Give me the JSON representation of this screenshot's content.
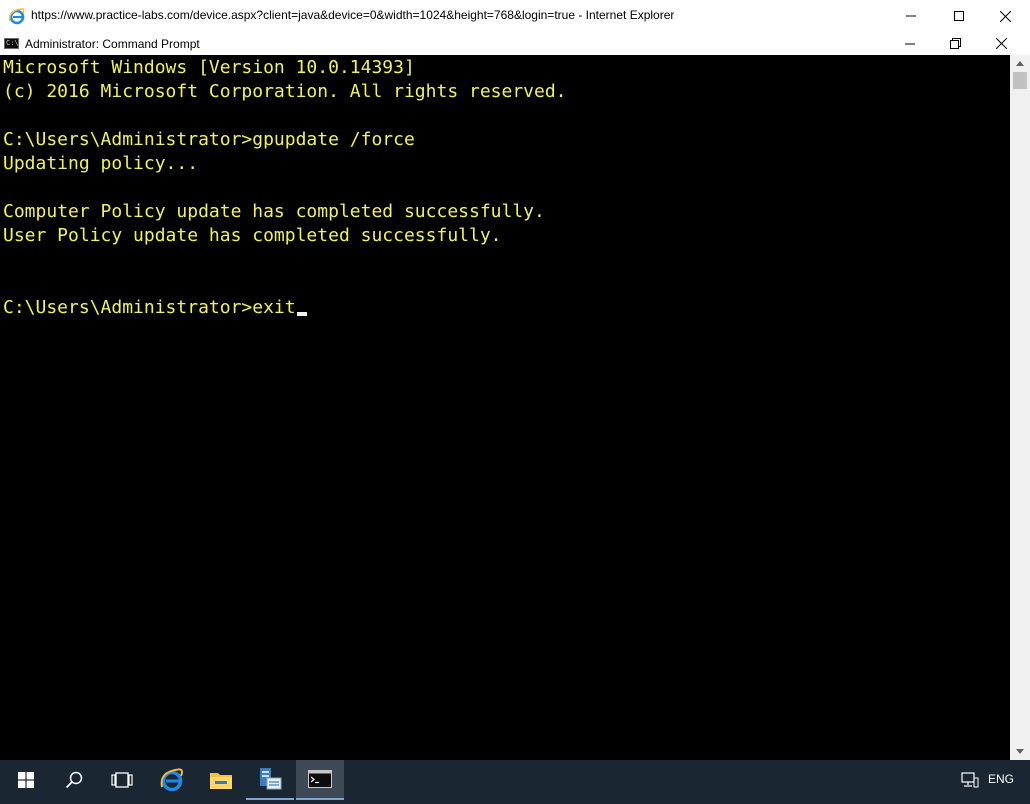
{
  "browser": {
    "title": "https://www.practice-labs.com/device.aspx?client=java&device=0&width=1024&height=768&login=true - Internet Explorer"
  },
  "cmd": {
    "title": "Administrator: Command Prompt",
    "lines": [
      "Microsoft Windows [Version 10.0.14393]",
      "(c) 2016 Microsoft Corporation. All rights reserved.",
      "",
      "C:\\Users\\Administrator>gpupdate /force",
      "Updating policy...",
      "",
      "Computer Policy update has completed successfully.",
      "User Policy update has completed successfully.",
      "",
      "",
      "C:\\Users\\Administrator>exit"
    ],
    "text_color": "#f2f25a",
    "background": "#000000"
  },
  "taskbar": {
    "items": [
      "start-icon",
      "search-icon",
      "task-view-icon",
      "internet-explorer-icon",
      "file-explorer-icon",
      "server-manager-icon",
      "command-prompt-icon"
    ],
    "language": "ENG"
  }
}
